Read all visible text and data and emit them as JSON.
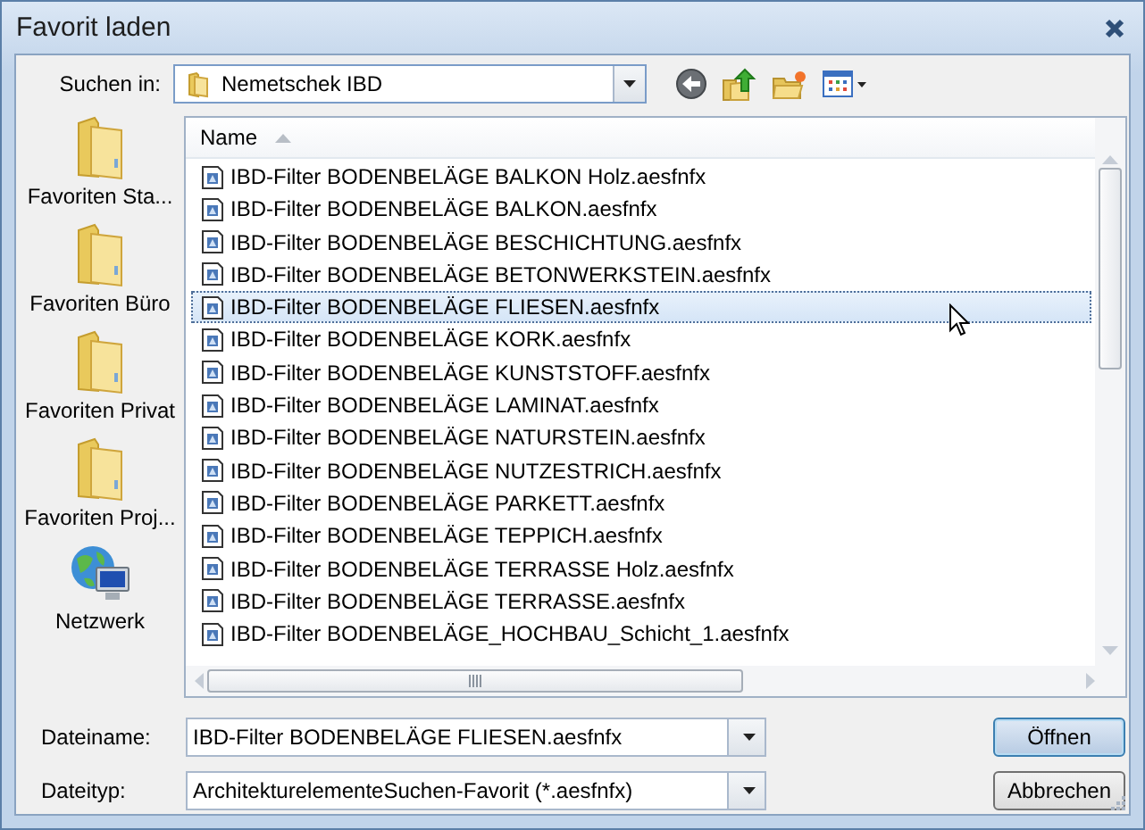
{
  "window": {
    "title": "Favorit laden"
  },
  "look_in": {
    "label": "Suchen in:",
    "value": "Nemetschek IBD"
  },
  "places": [
    {
      "label": "Favoriten Sta...",
      "kind": "folder"
    },
    {
      "label": "Favoriten Büro",
      "kind": "folder"
    },
    {
      "label": "Favoriten Privat",
      "kind": "folder"
    },
    {
      "label": "Favoriten Proj...",
      "kind": "folder"
    },
    {
      "label": "Netzwerk",
      "kind": "network"
    }
  ],
  "file_list": {
    "header": {
      "label": "Name",
      "sort_ascending": true
    },
    "files": [
      {
        "name": "IBD-Filter BODENBELÄGE BALKON Holz.aesfnfx",
        "selected": false
      },
      {
        "name": "IBD-Filter BODENBELÄGE BALKON.aesfnfx",
        "selected": false
      },
      {
        "name": "IBD-Filter BODENBELÄGE BESCHICHTUNG.aesfnfx",
        "selected": false
      },
      {
        "name": "IBD-Filter BODENBELÄGE BETONWERKSTEIN.aesfnfx",
        "selected": false
      },
      {
        "name": "IBD-Filter BODENBELÄGE FLIESEN.aesfnfx",
        "selected": true
      },
      {
        "name": "IBD-Filter BODENBELÄGE KORK.aesfnfx",
        "selected": false
      },
      {
        "name": "IBD-Filter BODENBELÄGE KUNSTSTOFF.aesfnfx",
        "selected": false
      },
      {
        "name": "IBD-Filter BODENBELÄGE LAMINAT.aesfnfx",
        "selected": false
      },
      {
        "name": "IBD-Filter BODENBELÄGE NATURSTEIN.aesfnfx",
        "selected": false
      },
      {
        "name": "IBD-Filter BODENBELÄGE NUTZESTRICH.aesfnfx",
        "selected": false
      },
      {
        "name": "IBD-Filter BODENBELÄGE PARKETT.aesfnfx",
        "selected": false
      },
      {
        "name": "IBD-Filter BODENBELÄGE TEPPICH.aesfnfx",
        "selected": false
      },
      {
        "name": "IBD-Filter BODENBELÄGE TERRASSE Holz.aesfnfx",
        "selected": false
      },
      {
        "name": "IBD-Filter BODENBELÄGE TERRASSE.aesfnfx",
        "selected": false
      },
      {
        "name": "IBD-Filter BODENBELÄGE_HOCHBAU_Schicht_1.aesfnfx",
        "selected": false
      }
    ]
  },
  "file_name": {
    "label": "Dateiname:",
    "value": "IBD-Filter BODENBELÄGE FLIESEN.aesfnfx"
  },
  "file_type": {
    "label": "Dateityp:",
    "value": "ArchitekturelementeSuchen-Favorit (*.aesfnfx)"
  },
  "buttons": [
    {
      "label": "Öffnen",
      "kind": "default"
    },
    {
      "label": "Abbrechen",
      "kind": "normal"
    }
  ]
}
